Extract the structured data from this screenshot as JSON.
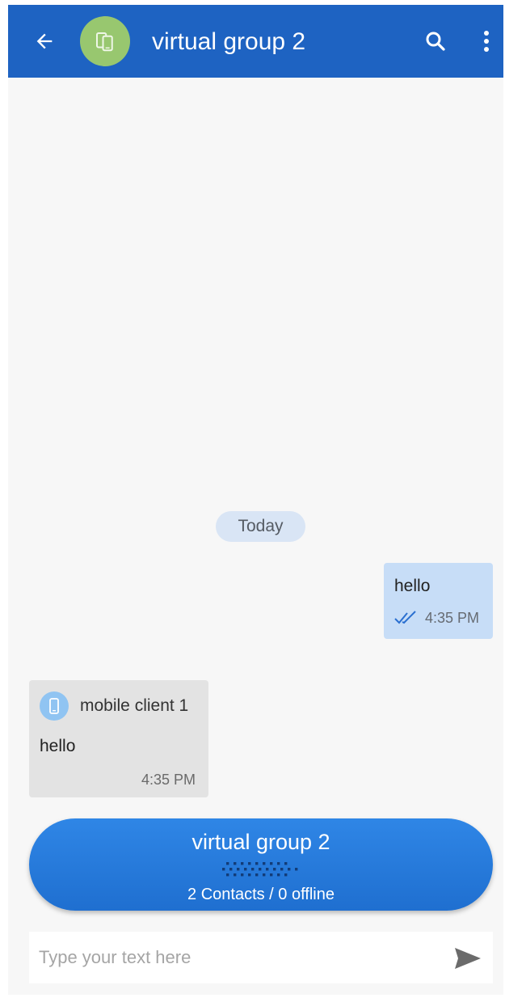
{
  "header": {
    "title": "virtual group 2",
    "back_icon": "arrow-back-icon",
    "avatar_icon": "devices-icon",
    "avatar_color": "#98c76f",
    "search_icon": "search-icon",
    "more_icon": "more-vert-icon",
    "bar_color": "#1e63c2"
  },
  "chat": {
    "date_label": "Today",
    "messages": [
      {
        "direction": "outgoing",
        "text": "hello",
        "time": "4:35 PM",
        "status_icon": "double-check-icon"
      },
      {
        "direction": "incoming",
        "sender": "mobile client 1",
        "sender_icon": "phone-icon",
        "text": "hello",
        "time": "4:35 PM"
      }
    ]
  },
  "group_bar": {
    "title": "virtual group 2",
    "subtitle": "2 Contacts / 0 offline",
    "handle_icon": "grip-dots-icon"
  },
  "composer": {
    "placeholder": "Type your text here",
    "value": "",
    "send_icon": "send-icon"
  }
}
